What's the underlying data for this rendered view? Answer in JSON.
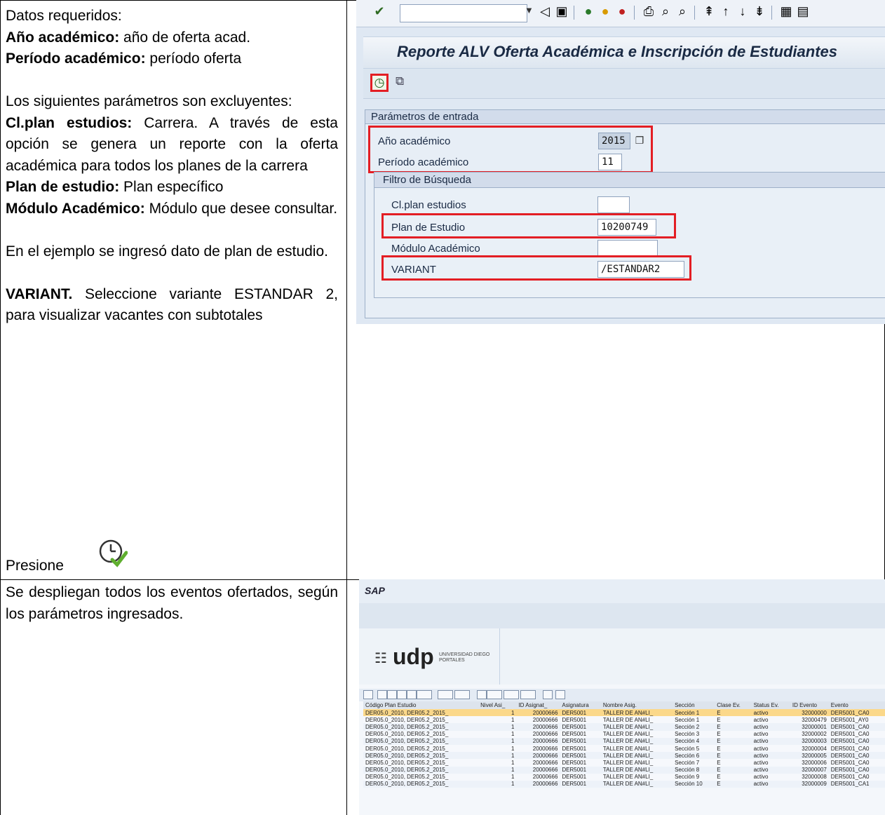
{
  "row1": {
    "intro": "Datos requeridos:",
    "year_label": "Año académico:",
    "year_text": " año de oferta acad.",
    "period_label": "Período académico:",
    "period_text": " período oferta",
    "exclusive_line": "Los siguientes parámetros son excluyentes:",
    "clplan_label": "Cl.plan estudios:",
    "clplan_text": " Carrera. A través de esta opción se genera un reporte con la oferta académica para todos los planes de la carrera",
    "plan_label": "Plan de estudio:",
    "plan_text": " Plan específico",
    "modulo_label": "Módulo Académico:",
    "modulo_text": " Módulo que desee consultar.",
    "example": "En el ejemplo se ingresó dato de plan de estudio.",
    "variant_label": "VARIANT.",
    "variant_text": " Seleccione variante ESTANDAR 2, para visualizar vacantes con subtotales",
    "press": "Presione"
  },
  "row2": {
    "text": "Se despliegan todos los eventos ofertados, según los parámetros ingresados."
  },
  "sap_selection": {
    "title": "Reporte ALV Oferta Académica e Inscripción de Estudiantes",
    "group_title": "Parámetros de entrada",
    "year_label": "Año académico",
    "year_value": "2015",
    "period_label": "Período académico",
    "period_value": "11",
    "filter_title": "Filtro de Búsqueda",
    "clplan_label": "Cl.plan estudios",
    "clplan_value": "",
    "plan_label": "Plan de Estudio",
    "plan_value": "10200749",
    "modulo_label": "Módulo Académico",
    "modulo_value": "",
    "variant_label": "VARIANT",
    "variant_value": "/ESTANDAR2"
  },
  "sap_list": {
    "header": "SAP",
    "logo_text": "udp",
    "logo_sub": "UNIVERSIDAD DIEGO PORTALES",
    "columns": [
      "Código Plan Estudio",
      "Nivel Asi_",
      "ID Asignat_",
      "Asignatura",
      "Nombre Asig.",
      "Sección",
      "Clase Ev.",
      "Status Ev.",
      "ID Evento",
      "Evento"
    ],
    "rows": [
      [
        "DER05.0_2010, DER05.2_2015_",
        "1",
        "20000666",
        "DER5001",
        "TALLER DE AN#LI_",
        "Sección 1",
        "E",
        "activo",
        "32000000",
        "DER5001_CA0"
      ],
      [
        "DER05.0_2010, DER05.2_2015_",
        "1",
        "20000666",
        "DER5001",
        "TALLER DE AN#LI_",
        "Sección 1",
        "E",
        "activo",
        "32000479",
        "DER5001_AY0"
      ],
      [
        "DER05.0_2010, DER05.2_2015_",
        "1",
        "20000666",
        "DER5001",
        "TALLER DE AN#LI_",
        "Sección 2",
        "E",
        "activo",
        "32000001",
        "DER5001_CA0"
      ],
      [
        "DER05.0_2010, DER05.2_2015_",
        "1",
        "20000666",
        "DER5001",
        "TALLER DE AN#LI_",
        "Sección 3",
        "E",
        "activo",
        "32000002",
        "DER5001_CA0"
      ],
      [
        "DER05.0_2010, DER05.2_2015_",
        "1",
        "20000666",
        "DER5001",
        "TALLER DE AN#LI_",
        "Sección 4",
        "E",
        "activo",
        "32000003",
        "DER5001_CA0"
      ],
      [
        "DER05.0_2010, DER05.2_2015_",
        "1",
        "20000666",
        "DER5001",
        "TALLER DE AN#LI_",
        "Sección 5",
        "E",
        "activo",
        "32000004",
        "DER5001_CA0"
      ],
      [
        "DER05.0_2010, DER05.2_2015_",
        "1",
        "20000666",
        "DER5001",
        "TALLER DE AN#LI_",
        "Sección 6",
        "E",
        "activo",
        "32000005",
        "DER5001_CA0"
      ],
      [
        "DER05.0_2010, DER05.2_2015_",
        "1",
        "20000666",
        "DER5001",
        "TALLER DE AN#LI_",
        "Sección 7",
        "E",
        "activo",
        "32000006",
        "DER5001_CA0"
      ],
      [
        "DER05.0_2010, DER05.2_2015_",
        "1",
        "20000666",
        "DER5001",
        "TALLER DE AN#LI_",
        "Sección 8",
        "E",
        "activo",
        "32000007",
        "DER5001_CA0"
      ],
      [
        "DER05.0_2010, DER05.2_2015_",
        "1",
        "20000666",
        "DER5001",
        "TALLER DE AN#LI_",
        "Sección 9",
        "E",
        "activo",
        "32000008",
        "DER5001_CA0"
      ],
      [
        "DER05.0_2010, DER05.2_2015_",
        "1",
        "20000666",
        "DER5001",
        "TALLER DE AN#LI_",
        "Sección 10",
        "E",
        "activo",
        "32000009",
        "DER5001_CA1"
      ]
    ]
  },
  "colors": {
    "highlight_red": "#e31e24",
    "sap_bg": "#dfe8f3",
    "row_selected": "#fbd88a"
  }
}
